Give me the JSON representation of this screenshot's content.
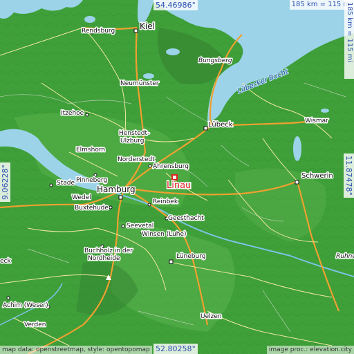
{
  "coords": {
    "top": "54.46986°",
    "bottom": "52.80258°",
    "left": "9.06228°",
    "right": "11.87478°"
  },
  "scale": {
    "horizontal": "185 km = 115 mi",
    "vertical": "185 km = 115 mi"
  },
  "attribution": {
    "left": "map data: openstreetmap, style: opentopomap",
    "right": "image proc.: elevation.city"
  },
  "target": {
    "name": "Linau"
  },
  "water_labels": {
    "bay": "Lübecker Bucht"
  },
  "places": {
    "kiel": "Kiel",
    "rendsburg": "Rendsburg",
    "neumuenster": "Neumünster",
    "bungsberg": "Bungsberg",
    "itzehoe": "Itzehoe",
    "luebeck": "Lübeck",
    "wismar": "Wismar",
    "elmshorn": "Elmshorn",
    "henstedt": "Henstedt-\nUlzburg",
    "norderstedt": "Norderstedt",
    "ahrensburg": "Ahrensburg",
    "schwerin": "Schwerin",
    "stade": "Stade",
    "pinneberg": "Pinneberg",
    "hamburg": "Hamburg",
    "wedel": "Wedel",
    "buxtehude": "Buxtehude",
    "reinbek": "Reinbek",
    "geesthacht": "Geesthacht",
    "seevetal": "Seevetal",
    "winsen": "Winsen (Luhe)",
    "buchholz": "Buchholz in der\nNordheide",
    "lueneburg": "Lüneburg",
    "achim": "Achim (Weser)",
    "verden": "Verden",
    "uelzen": "Uelzen",
    "rohne": "Ruhne",
    "eck": "eck"
  }
}
